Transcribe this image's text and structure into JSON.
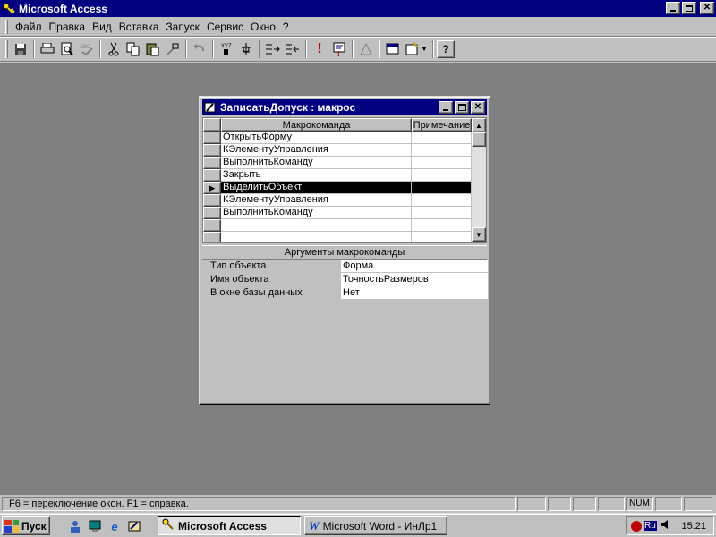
{
  "app": {
    "title": "Microsoft Access",
    "title_icon": "key-icon",
    "controls": [
      "minimize",
      "restore",
      "close"
    ]
  },
  "menu": {
    "items": [
      {
        "label": "Файл"
      },
      {
        "label": "Правка"
      },
      {
        "label": "Вид"
      },
      {
        "label": "Вставка"
      },
      {
        "label": "Запуск"
      },
      {
        "label": "Сервис"
      },
      {
        "label": "Окно"
      },
      {
        "label": "?"
      }
    ]
  },
  "toolbar": {
    "icons": [
      "save-icon",
      "print-icon",
      "print-preview-icon",
      "spelling-icon",
      "cut-icon",
      "copy-icon",
      "paste-icon",
      "format-painter-icon",
      "undo-icon",
      "macro-names-icon",
      "conditions-icon",
      "insert-row-icon",
      "delete-row-icon",
      "run-icon",
      "step-icon",
      "build-icon",
      "database-window-icon",
      "new-object-icon",
      "help-icon"
    ]
  },
  "macro_window": {
    "title": "ЗаписатьДопуск : макрос",
    "columns": {
      "action": "Макрокоманда",
      "comment": "Примечание"
    },
    "rows": [
      {
        "action": "ОткрытьФорму",
        "comment": ""
      },
      {
        "action": "КЭлементуУправления",
        "comment": ""
      },
      {
        "action": "ВыполнитьКоманду",
        "comment": ""
      },
      {
        "action": "Закрыть",
        "comment": ""
      },
      {
        "action": "ВыделитьОбъект",
        "comment": ""
      },
      {
        "action": "КЭлементуУправления",
        "comment": ""
      },
      {
        "action": "ВыполнитьКоманду",
        "comment": ""
      },
      {
        "action": "",
        "comment": ""
      },
      {
        "action": "",
        "comment": ""
      }
    ],
    "selected_row_index": 4,
    "arguments_label": "Аргументы макрокоманды",
    "arguments": [
      {
        "label": "Тип объекта",
        "value": "Форма"
      },
      {
        "label": "Имя объекта",
        "value": "ТочностьРазмеров"
      },
      {
        "label": "В окне базы данных",
        "value": "Нет"
      }
    ]
  },
  "statusbar": {
    "text": "F6 = переключение окон.  F1 = справка.",
    "num": "NUM"
  },
  "taskbar": {
    "start_label": "Пуск",
    "tasks": [
      {
        "label": "Microsoft Access",
        "active": true
      },
      {
        "label": "Microsoft Word - ИнЛр1",
        "active": false
      }
    ],
    "language": "Ru",
    "clock": "15:21"
  },
  "colors": {
    "titlebar": "#000080",
    "workspace": "#808080",
    "face": "#c0c0c0",
    "selection": "#000000"
  }
}
